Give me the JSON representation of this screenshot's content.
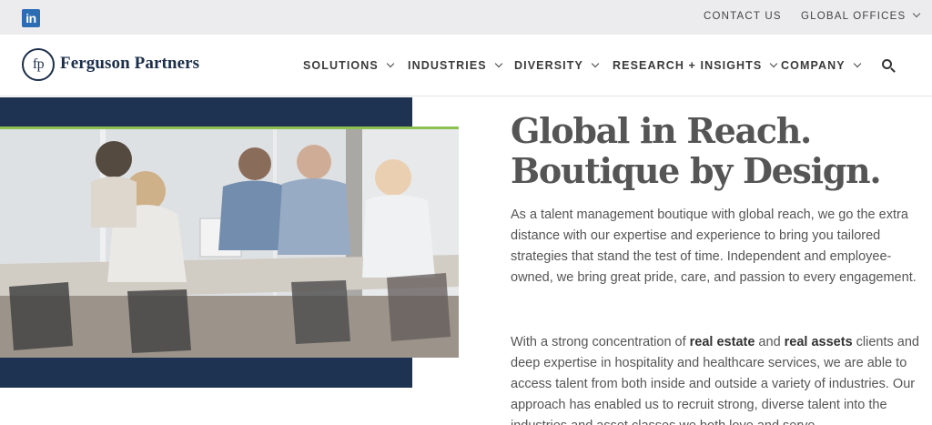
{
  "topbar": {
    "linkedin_label": "in",
    "contact_label": "CONTACT US",
    "global_offices_label": "GLOBAL OFFICES"
  },
  "header": {
    "logo_mark": "fp",
    "logo_text": "Ferguson Partners",
    "nav": [
      {
        "label": "SOLUTIONS"
      },
      {
        "label": "INDUSTRIES"
      },
      {
        "label": "DIVERSITY"
      },
      {
        "label": "RESEARCH + INSIGHTS"
      },
      {
        "label": "COMPANY"
      }
    ]
  },
  "hero": {
    "heading_line1": "Global in Reach.",
    "heading_line2": "Boutique by Design.",
    "paragraph1": "As a talent management boutique with global reach, we go the extra distance with our expertise and experience to bring you tailored strategies that stand the test of time. Independent and employee-owned, we bring great pride, care, and passion to every engagement.",
    "paragraph2_before": "With a strong concentration of ",
    "paragraph2_bold1": "real estate",
    "paragraph2_mid": " and ",
    "paragraph2_bold2": "real assets",
    "paragraph2_after": " clients and deep expertise in hospitality and healthcare services, we are able to access talent from both inside and outside a variety of industries. Our approach has enabled us to recruit strong, diverse talent into the industries and asset classes we both love and serve."
  },
  "colors": {
    "navy": "#1e3352",
    "accent_green": "#8cc152",
    "linkedin_blue": "#2a6db4",
    "heading_gray": "#555555"
  }
}
